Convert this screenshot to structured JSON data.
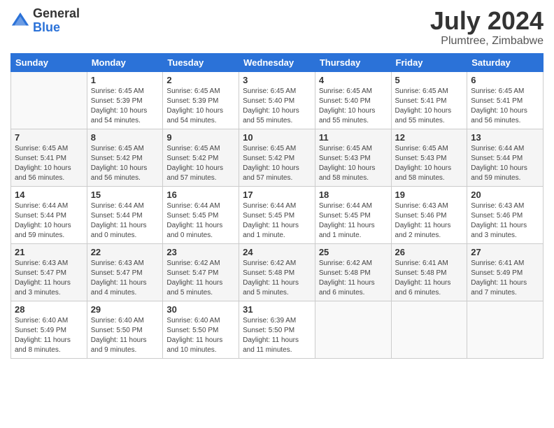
{
  "logo": {
    "general": "General",
    "blue": "Blue"
  },
  "title": "July 2024",
  "subtitle": "Plumtree, Zimbabwe",
  "days_header": [
    "Sunday",
    "Monday",
    "Tuesday",
    "Wednesday",
    "Thursday",
    "Friday",
    "Saturday"
  ],
  "weeks": [
    [
      {
        "num": "",
        "info": ""
      },
      {
        "num": "1",
        "info": "Sunrise: 6:45 AM\nSunset: 5:39 PM\nDaylight: 10 hours\nand 54 minutes."
      },
      {
        "num": "2",
        "info": "Sunrise: 6:45 AM\nSunset: 5:39 PM\nDaylight: 10 hours\nand 54 minutes."
      },
      {
        "num": "3",
        "info": "Sunrise: 6:45 AM\nSunset: 5:40 PM\nDaylight: 10 hours\nand 55 minutes."
      },
      {
        "num": "4",
        "info": "Sunrise: 6:45 AM\nSunset: 5:40 PM\nDaylight: 10 hours\nand 55 minutes."
      },
      {
        "num": "5",
        "info": "Sunrise: 6:45 AM\nSunset: 5:41 PM\nDaylight: 10 hours\nand 55 minutes."
      },
      {
        "num": "6",
        "info": "Sunrise: 6:45 AM\nSunset: 5:41 PM\nDaylight: 10 hours\nand 56 minutes."
      }
    ],
    [
      {
        "num": "7",
        "info": "Sunrise: 6:45 AM\nSunset: 5:41 PM\nDaylight: 10 hours\nand 56 minutes."
      },
      {
        "num": "8",
        "info": "Sunrise: 6:45 AM\nSunset: 5:42 PM\nDaylight: 10 hours\nand 56 minutes."
      },
      {
        "num": "9",
        "info": "Sunrise: 6:45 AM\nSunset: 5:42 PM\nDaylight: 10 hours\nand 57 minutes."
      },
      {
        "num": "10",
        "info": "Sunrise: 6:45 AM\nSunset: 5:42 PM\nDaylight: 10 hours\nand 57 minutes."
      },
      {
        "num": "11",
        "info": "Sunrise: 6:45 AM\nSunset: 5:43 PM\nDaylight: 10 hours\nand 58 minutes."
      },
      {
        "num": "12",
        "info": "Sunrise: 6:45 AM\nSunset: 5:43 PM\nDaylight: 10 hours\nand 58 minutes."
      },
      {
        "num": "13",
        "info": "Sunrise: 6:44 AM\nSunset: 5:44 PM\nDaylight: 10 hours\nand 59 minutes."
      }
    ],
    [
      {
        "num": "14",
        "info": "Sunrise: 6:44 AM\nSunset: 5:44 PM\nDaylight: 10 hours\nand 59 minutes."
      },
      {
        "num": "15",
        "info": "Sunrise: 6:44 AM\nSunset: 5:44 PM\nDaylight: 11 hours\nand 0 minutes."
      },
      {
        "num": "16",
        "info": "Sunrise: 6:44 AM\nSunset: 5:45 PM\nDaylight: 11 hours\nand 0 minutes."
      },
      {
        "num": "17",
        "info": "Sunrise: 6:44 AM\nSunset: 5:45 PM\nDaylight: 11 hours\nand 1 minute."
      },
      {
        "num": "18",
        "info": "Sunrise: 6:44 AM\nSunset: 5:45 PM\nDaylight: 11 hours\nand 1 minute."
      },
      {
        "num": "19",
        "info": "Sunrise: 6:43 AM\nSunset: 5:46 PM\nDaylight: 11 hours\nand 2 minutes."
      },
      {
        "num": "20",
        "info": "Sunrise: 6:43 AM\nSunset: 5:46 PM\nDaylight: 11 hours\nand 3 minutes."
      }
    ],
    [
      {
        "num": "21",
        "info": "Sunrise: 6:43 AM\nSunset: 5:47 PM\nDaylight: 11 hours\nand 3 minutes."
      },
      {
        "num": "22",
        "info": "Sunrise: 6:43 AM\nSunset: 5:47 PM\nDaylight: 11 hours\nand 4 minutes."
      },
      {
        "num": "23",
        "info": "Sunrise: 6:42 AM\nSunset: 5:47 PM\nDaylight: 11 hours\nand 5 minutes."
      },
      {
        "num": "24",
        "info": "Sunrise: 6:42 AM\nSunset: 5:48 PM\nDaylight: 11 hours\nand 5 minutes."
      },
      {
        "num": "25",
        "info": "Sunrise: 6:42 AM\nSunset: 5:48 PM\nDaylight: 11 hours\nand 6 minutes."
      },
      {
        "num": "26",
        "info": "Sunrise: 6:41 AM\nSunset: 5:48 PM\nDaylight: 11 hours\nand 6 minutes."
      },
      {
        "num": "27",
        "info": "Sunrise: 6:41 AM\nSunset: 5:49 PM\nDaylight: 11 hours\nand 7 minutes."
      }
    ],
    [
      {
        "num": "28",
        "info": "Sunrise: 6:40 AM\nSunset: 5:49 PM\nDaylight: 11 hours\nand 8 minutes."
      },
      {
        "num": "29",
        "info": "Sunrise: 6:40 AM\nSunset: 5:50 PM\nDaylight: 11 hours\nand 9 minutes."
      },
      {
        "num": "30",
        "info": "Sunrise: 6:40 AM\nSunset: 5:50 PM\nDaylight: 11 hours\nand 10 minutes."
      },
      {
        "num": "31",
        "info": "Sunrise: 6:39 AM\nSunset: 5:50 PM\nDaylight: 11 hours\nand 11 minutes."
      },
      {
        "num": "",
        "info": ""
      },
      {
        "num": "",
        "info": ""
      },
      {
        "num": "",
        "info": ""
      }
    ]
  ]
}
